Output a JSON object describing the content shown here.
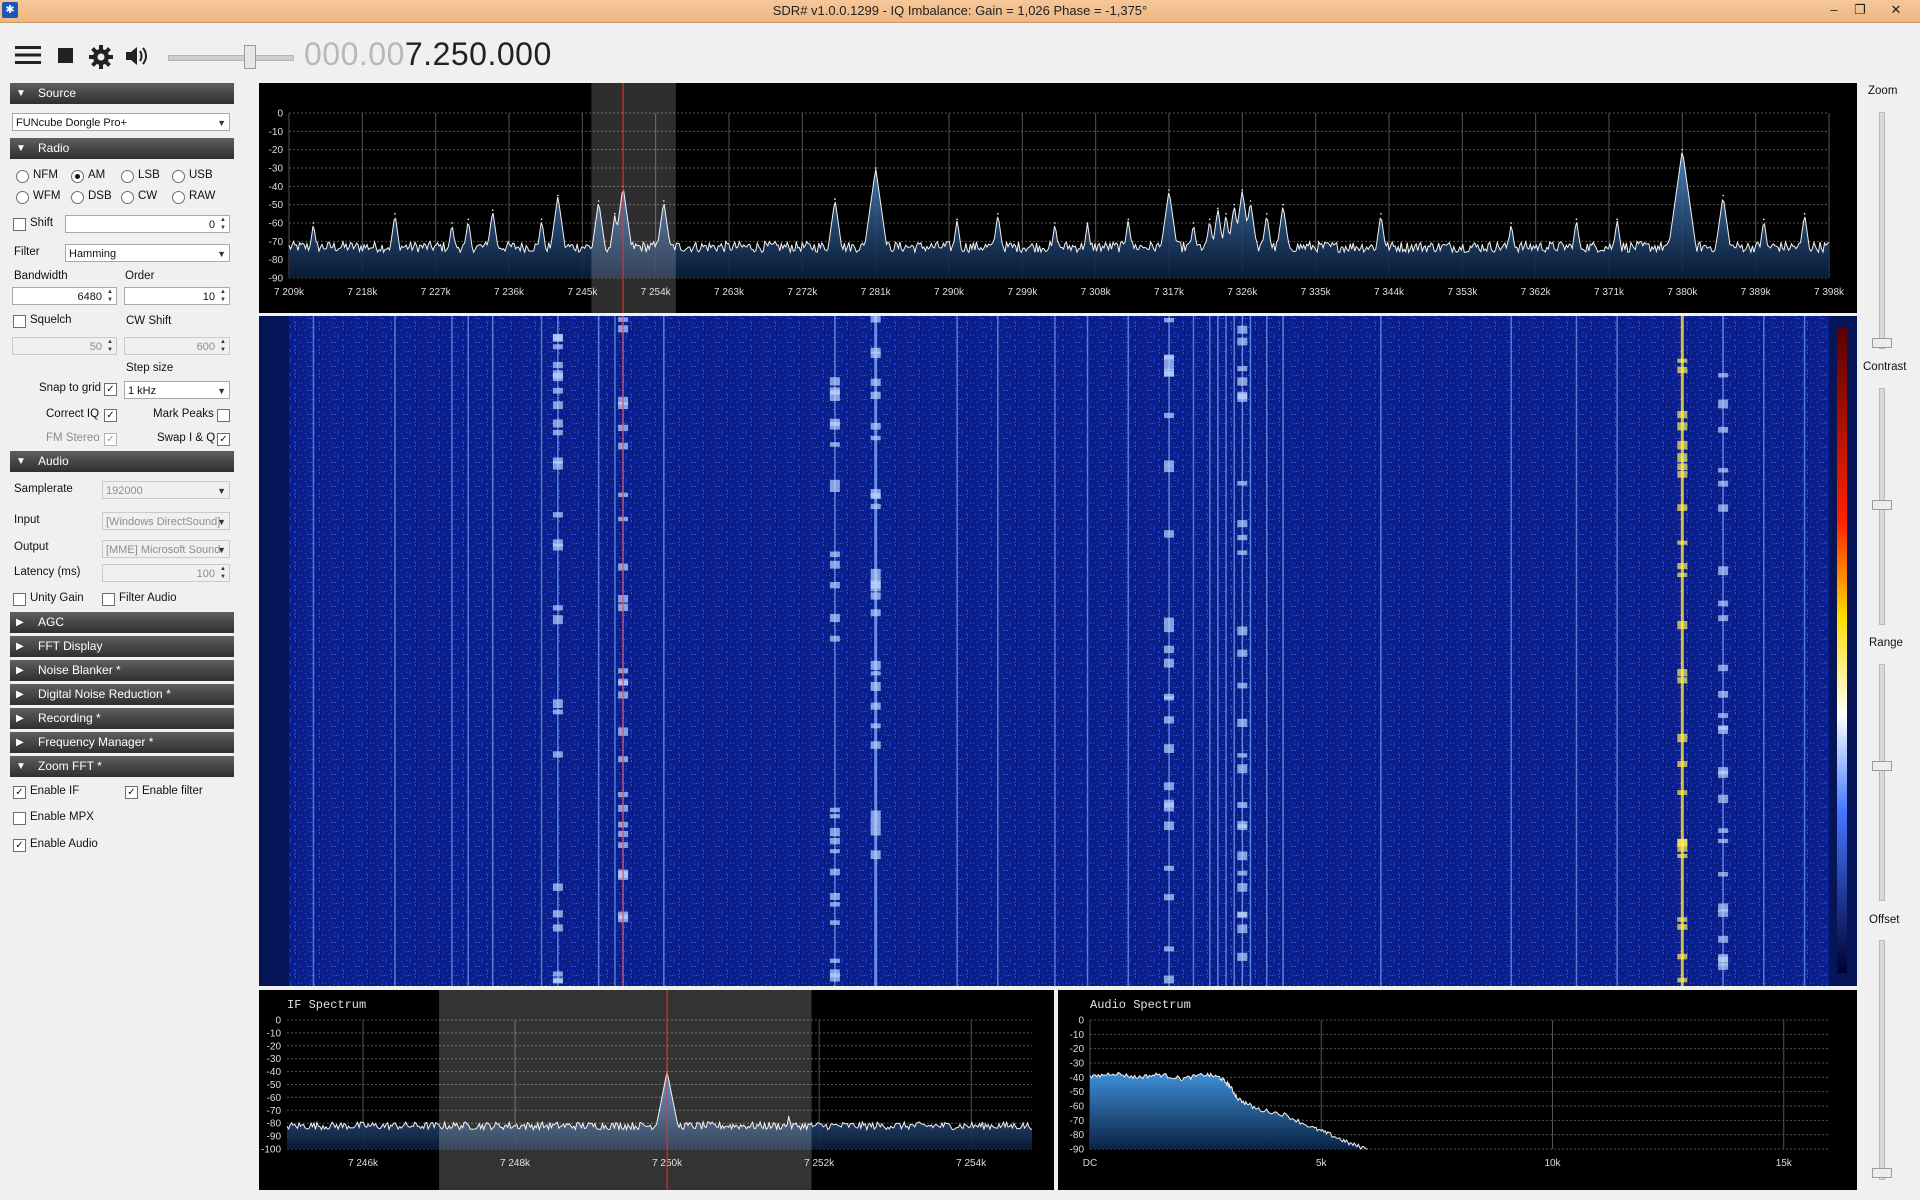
{
  "window": {
    "title": "SDR# v1.0.0.1299 - IQ Imbalance: Gain = 1,026 Phase = -1,375°",
    "controls": [
      "–",
      "❐",
      "✕"
    ]
  },
  "toolbar": {
    "icons": [
      "menu-icon",
      "stop-icon",
      "gear-icon",
      "speaker-icon"
    ],
    "freq_dim": "000.00",
    "freq_lit": "7.250.000",
    "volume": 0.55
  },
  "source": {
    "header": "Source",
    "device": "FUNcube Dongle Pro+"
  },
  "radio": {
    "header": "Radio",
    "modes": [
      "NFM",
      "AM",
      "LSB",
      "USB",
      "WFM",
      "DSB",
      "CW",
      "RAW"
    ],
    "selected_mode": "AM",
    "shift_label": "Shift",
    "shift_value": "0",
    "filter_label": "Filter",
    "filter_value": "Hamming",
    "bandwidth_label": "Bandwidth",
    "bandwidth_value": "6480",
    "order_label": "Order",
    "order_value": "10",
    "squelch_label": "Squelch",
    "squelch_value": "50",
    "cwshift_label": "CW Shift",
    "cwshift_value": "600",
    "stepsize_label": "Step size",
    "snap_label": "Snap to grid",
    "step_value": "1 kHz",
    "correctiq_label": "Correct IQ",
    "markpeaks_label": "Mark Peaks",
    "fmstereo_label": "FM Stereo",
    "swapiq_label": "Swap I & Q"
  },
  "audio": {
    "header": "Audio",
    "samplerate_label": "Samplerate",
    "samplerate_value": "192000",
    "input_label": "Input",
    "input_value": "[Windows DirectSound]",
    "output_label": "Output",
    "output_value": "[MME] Microsoft Sound",
    "latency_label": "Latency (ms)",
    "latency_value": "100",
    "unitygain_label": "Unity Gain",
    "filteraudio_label": "Filter Audio"
  },
  "collapsed_sections": [
    "AGC",
    "FFT Display",
    "Noise Blanker *",
    "Digital Noise Reduction *",
    "Recording *",
    "Frequency Manager *"
  ],
  "zoomfft": {
    "header": "Zoom FFT *",
    "enable_if": "Enable IF",
    "enable_filter": "Enable filter",
    "enable_mpx": "Enable MPX",
    "enable_audio": "Enable Audio"
  },
  "right": {
    "zoom": "Zoom",
    "contrast": "Contrast",
    "range": "Range",
    "offset": "Offset"
  },
  "if_spectrum": {
    "title": "IF Spectrum"
  },
  "audio_spectrum": {
    "title": "Audio Spectrum"
  },
  "chart_data": [
    {
      "type": "line",
      "name": "main-spectrum",
      "y_ticks": [
        "0",
        "-10",
        "-20",
        "-30",
        "-40",
        "-50",
        "-60",
        "-70",
        "-80",
        "-90"
      ],
      "x_ticks": [
        "7 209k",
        "7 218k",
        "7 227k",
        "7 236k",
        "7 245k",
        "7 254k",
        "7 263k",
        "7 272k",
        "7 281k",
        "7 290k",
        "7 299k",
        "7 308k",
        "7 317k",
        "7 326k",
        "7 335k",
        "7 344k",
        "7 353k",
        "7 362k",
        "7 371k",
        "7 380k",
        "7 389k",
        "7 398k"
      ],
      "xlim": [
        7209,
        7398
      ],
      "ylim": [
        -90,
        0
      ],
      "noise_floor": -73,
      "peaks": [
        [
          7212,
          -60
        ],
        [
          7222,
          -55
        ],
        [
          7229,
          -60
        ],
        [
          7231,
          -58
        ],
        [
          7234,
          -53
        ],
        [
          7240,
          -58
        ],
        [
          7242,
          -45
        ],
        [
          7247,
          -48
        ],
        [
          7249,
          -55
        ],
        [
          7250,
          -40
        ],
        [
          7255,
          -48
        ],
        [
          7276,
          -47
        ],
        [
          7281,
          -30
        ],
        [
          7291,
          -58
        ],
        [
          7296,
          -55
        ],
        [
          7303,
          -60
        ],
        [
          7307,
          -60
        ],
        [
          7312,
          -58
        ],
        [
          7317,
          -42
        ],
        [
          7320,
          -60
        ],
        [
          7322,
          -58
        ],
        [
          7323,
          -52
        ],
        [
          7324,
          -55
        ],
        [
          7325,
          -50
        ],
        [
          7326,
          -42
        ],
        [
          7327,
          -48
        ],
        [
          7329,
          -55
        ],
        [
          7331,
          -50
        ],
        [
          7343,
          -55
        ],
        [
          7359,
          -60
        ],
        [
          7367,
          -58
        ],
        [
          7372,
          -58
        ],
        [
          7380,
          -20
        ],
        [
          7385,
          -45
        ],
        [
          7390,
          -58
        ],
        [
          7395,
          -55
        ]
      ]
    },
    {
      "type": "line",
      "name": "if-spectrum",
      "y_ticks": [
        "0",
        "-10",
        "-20",
        "-30",
        "-40",
        "-50",
        "-60",
        "-70",
        "-80",
        "-90",
        "-100"
      ],
      "x_ticks": [
        "7 246k",
        "7 248k",
        "7 250k",
        "7 252k",
        "7 254k"
      ],
      "xlim": [
        7245.0,
        7254.8
      ],
      "ylim": [
        -100,
        0
      ],
      "noise_floor": -82,
      "peaks": [
        [
          7250.0,
          -40
        ],
        [
          7249.9,
          -70
        ],
        [
          7251.6,
          -75
        ]
      ]
    },
    {
      "type": "area",
      "name": "audio-spectrum",
      "y_ticks": [
        "0",
        "-10",
        "-20",
        "-30",
        "-40",
        "-50",
        "-60",
        "-70",
        "-80",
        "-90"
      ],
      "x_ticks": [
        "DC",
        "5k",
        "10k",
        "15k"
      ],
      "xlim": [
        0,
        16000
      ],
      "ylim": [
        -90,
        0
      ],
      "curve": [
        [
          0,
          -40
        ],
        [
          500,
          -37
        ],
        [
          1000,
          -40
        ],
        [
          1500,
          -38
        ],
        [
          2000,
          -41
        ],
        [
          2500,
          -38
        ],
        [
          2800,
          -40
        ],
        [
          3000,
          -45
        ],
        [
          3200,
          -55
        ],
        [
          3600,
          -62
        ],
        [
          4200,
          -66
        ],
        [
          4800,
          -75
        ],
        [
          5200,
          -80
        ],
        [
          5600,
          -86
        ],
        [
          6000,
          -90
        ]
      ]
    }
  ]
}
